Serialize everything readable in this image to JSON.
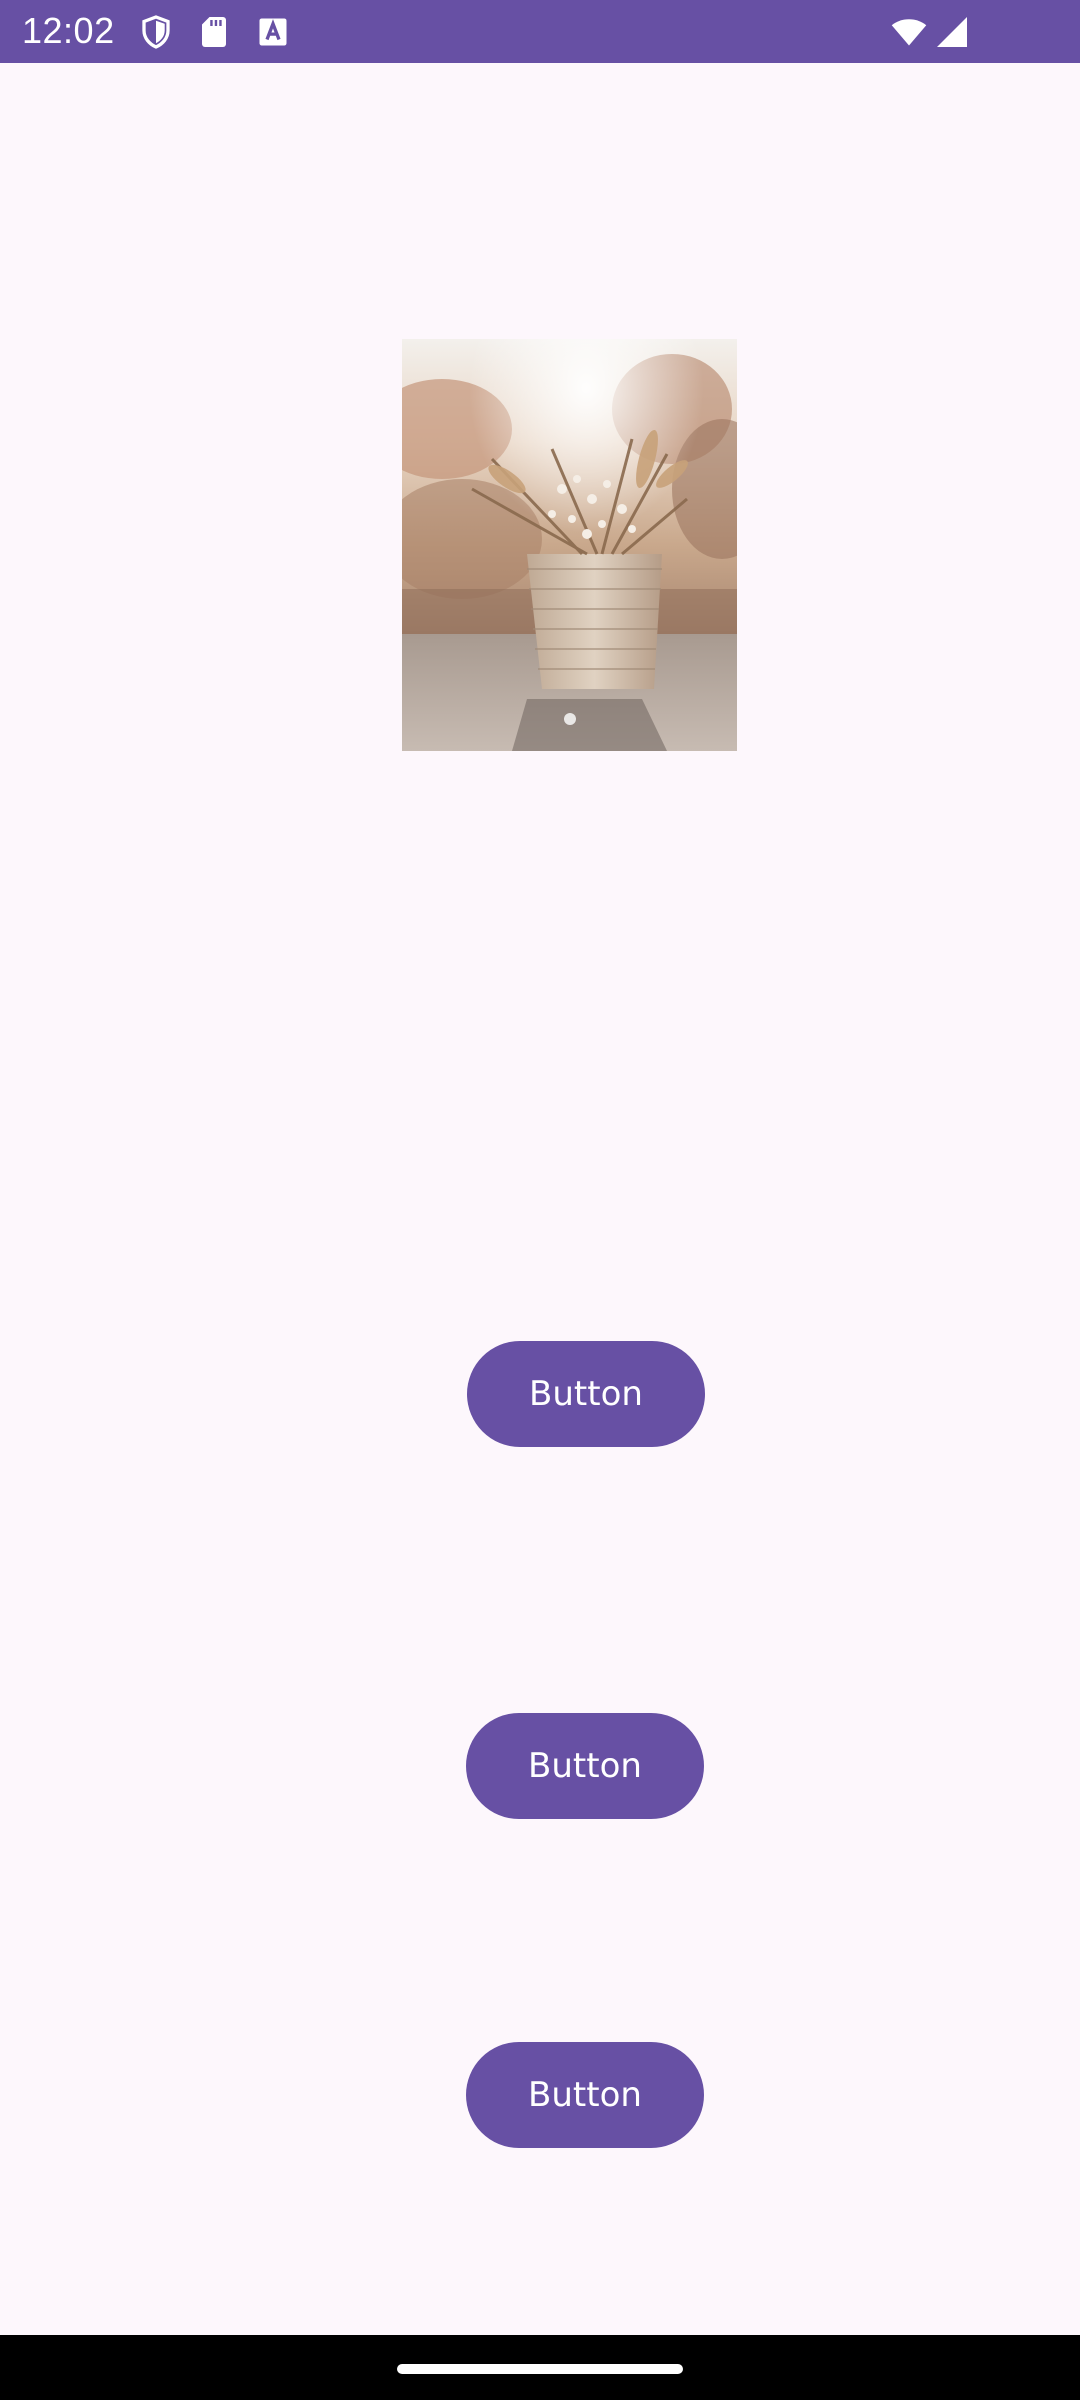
{
  "status_bar": {
    "time": "12:02",
    "background_color": "#6750A4",
    "left_icons": [
      "shield-icon",
      "sd-card-icon",
      "text-a-icon"
    ],
    "right_icons": [
      "wifi-icon",
      "signal-icon"
    ]
  },
  "content": {
    "image": {
      "subject": "basket-of-dried-flowers-photo"
    },
    "buttons": [
      {
        "label": "Button"
      },
      {
        "label": "Button"
      },
      {
        "label": "Button"
      }
    ],
    "button_color": "#6750A4",
    "background_color": "#FDF7FC"
  },
  "nav_bar": {
    "background_color": "#000000",
    "handle_color": "#FFFFFF"
  }
}
